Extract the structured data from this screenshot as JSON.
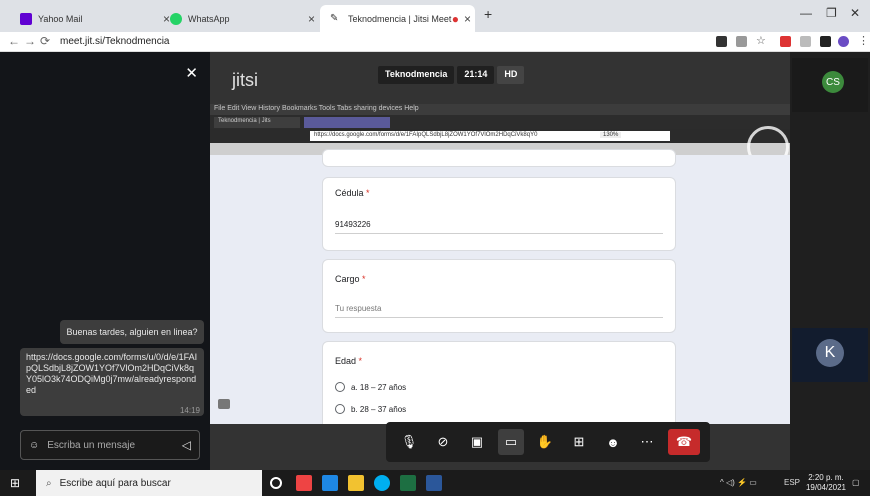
{
  "browser": {
    "tabs": [
      {
        "title": "Yahoo Mail",
        "icon": "yahoo-mail-icon"
      },
      {
        "title": "WhatsApp",
        "icon": "whatsapp-icon"
      },
      {
        "title": "Teknodmencia | Jitsi Meet",
        "icon": "jitsi-icon"
      }
    ],
    "url": "meet.jit.si/Teknodmencia"
  },
  "meeting": {
    "logo": "jitsi",
    "name": "Teknodmencia",
    "duration": "21:14",
    "quality": "HD"
  },
  "chat": {
    "messages": [
      {
        "text": "Buenas tardes, alguien en linea?"
      },
      {
        "text": "https://docs.google.com/forms/u/0/d/e/1FAIpQLSdbjL8jZOW1YOf7VlOm2HDqCiVk8qY05lO3k74ODQiMg0j7mw/alreadyrespond ed",
        "time": "14:19"
      }
    ],
    "input_placeholder": "Escriba un mensaje"
  },
  "shared_screen": {
    "ff_menu": "File  Edit  View  History  Bookmarks  Tools  Tabs sharing devices  Help",
    "ff_tab1": "Teknodmencia | Jits",
    "ff_url": "https://docs.google.com/forms/d/e/1FAIpQLSdbjL8jZOW1YOf7VlOm2HDqCiVk8qY0",
    "ff_zoom": "130%",
    "form": {
      "cedula": {
        "label": "Cédula",
        "value": "91493226"
      },
      "cargo": {
        "label": "Cargo",
        "placeholder": "Tu respuesta"
      },
      "edad": {
        "label": "Edad",
        "options": [
          "a. 18 – 27 años",
          "b. 28 – 37 años"
        ]
      },
      "required_mark": "*"
    }
  },
  "participants": [
    {
      "initials": "CS",
      "color": "#3c8a3c"
    },
    {
      "initials": "K",
      "color": "#5b6b89"
    }
  ],
  "taskbar": {
    "search_placeholder": "Escribe aquí para buscar",
    "lang": "ESP",
    "time": "2:20 p. m.",
    "date": "19/04/2021"
  }
}
